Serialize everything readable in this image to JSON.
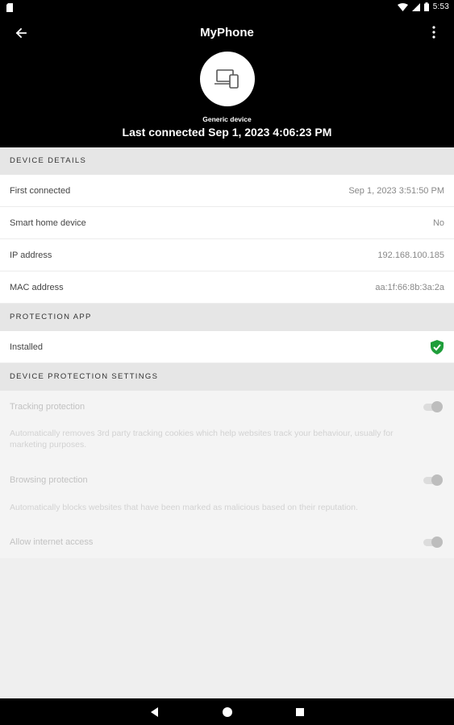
{
  "status_bar": {
    "time": "5:53"
  },
  "header": {
    "title": "MyPhone",
    "device_type": "Generic device",
    "last_connected": "Last connected Sep 1, 2023 4:06:23 PM"
  },
  "device_details": {
    "heading": "DEVICE DETAILS",
    "rows": [
      {
        "label": "First connected",
        "value": "Sep 1, 2023 3:51:50 PM"
      },
      {
        "label": "Smart home device",
        "value": "No"
      },
      {
        "label": "IP address",
        "value": "192.168.100.185"
      },
      {
        "label": "MAC address",
        "value": "aa:1f:66:8b:3a:2a"
      }
    ]
  },
  "protection_app": {
    "heading": "PROTECTION APP",
    "label": "Installed",
    "status_color": "#1e9e3a"
  },
  "protection_settings": {
    "heading": "DEVICE PROTECTION SETTINGS",
    "items": [
      {
        "title": "Tracking protection",
        "description": "Automatically removes 3rd party tracking cookies which help websites track your behaviour, usually for marketing purposes.",
        "enabled": true
      },
      {
        "title": "Browsing protection",
        "description": "Automatically blocks websites that have been marked as malicious based on their reputation.",
        "enabled": true
      },
      {
        "title": "Allow internet access",
        "description": "",
        "enabled": true
      }
    ]
  }
}
